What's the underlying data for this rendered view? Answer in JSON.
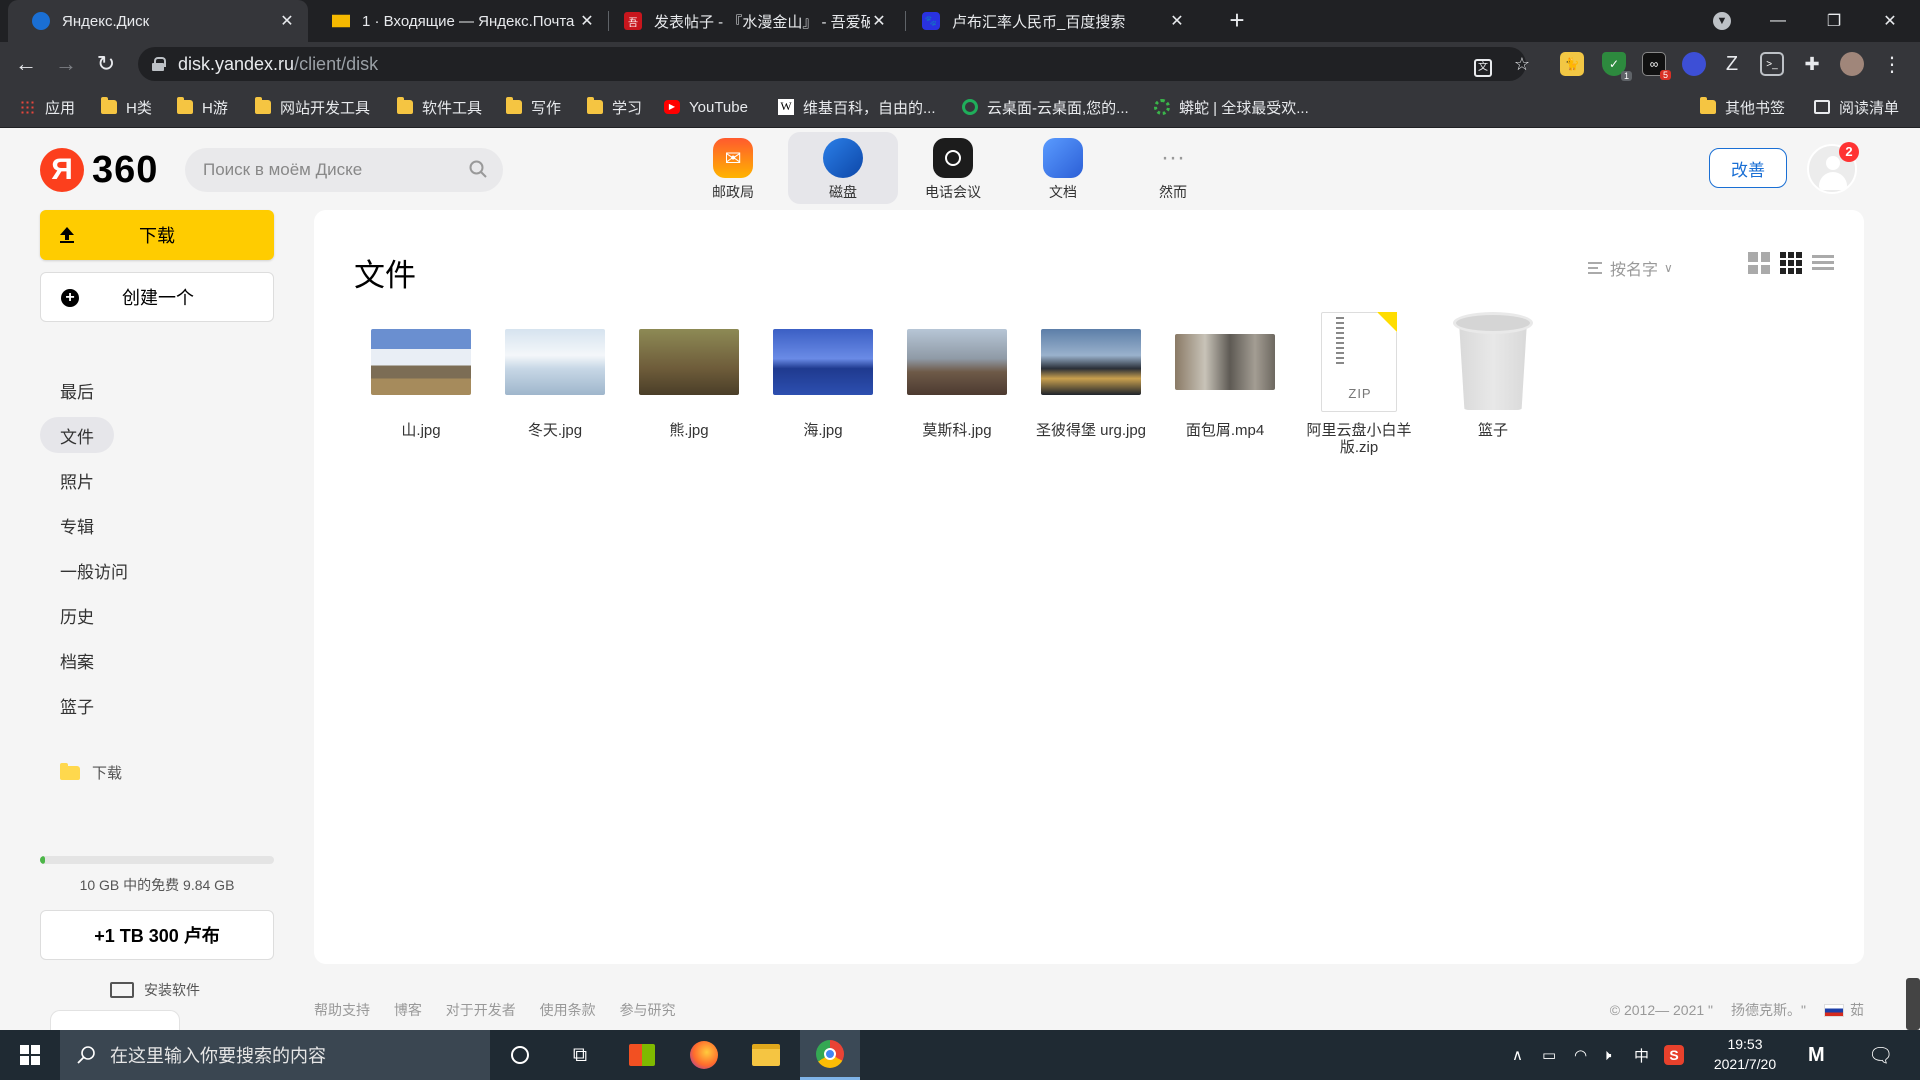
{
  "browser": {
    "tabs": [
      {
        "title": "Яндекс.Диск",
        "favicon": "yandex-disk-icon",
        "active": true
      },
      {
        "title": "1 · Входящие — Яндекс.Почта",
        "favicon": "yandex-mail-icon",
        "active": false
      },
      {
        "title": "发表帖子 - 『水漫金山』 - 吾爱破解",
        "favicon": "52pojie-icon",
        "active": false
      },
      {
        "title": "卢布汇率人民币_百度搜索",
        "favicon": "baidu-icon",
        "active": false
      }
    ],
    "url_host": "disk.yandex.ru",
    "url_path": "/client/disk",
    "bookmarks": [
      {
        "label": "应用",
        "type": "apps"
      },
      {
        "label": "H类",
        "type": "folder"
      },
      {
        "label": "H游",
        "type": "folder"
      },
      {
        "label": "网站开发工具",
        "type": "folder"
      },
      {
        "label": "软件工具",
        "type": "folder"
      },
      {
        "label": "写作",
        "type": "folder"
      },
      {
        "label": "学习",
        "type": "folder"
      },
      {
        "label": "YouTube",
        "type": "youtube"
      },
      {
        "label": "维基百科，自由的...",
        "type": "wikipedia"
      },
      {
        "label": "云桌面-云桌面,您的...",
        "type": "site"
      },
      {
        "label": "蟒蛇 | 全球最受欢...",
        "type": "site"
      },
      {
        "label": "其他书签",
        "type": "folder"
      },
      {
        "label": "阅读清单",
        "type": "reading-list"
      }
    ],
    "extension_badges": {
      "shield": "1",
      "ext5": "5"
    }
  },
  "disk": {
    "logo_letter": "Я",
    "logo_number": "360",
    "search_placeholder": "Поиск в моём Диске",
    "services": [
      {
        "label": "邮政局",
        "icon": "mail-icon",
        "color": "#ff4a2e",
        "active": false
      },
      {
        "label": "磁盘",
        "icon": "disk-icon",
        "color": "#1a6fd4",
        "active": true
      },
      {
        "label": "电话会议",
        "icon": "telemost-icon",
        "color": "#1c1c1c",
        "active": false
      },
      {
        "label": "文档",
        "icon": "docs-icon",
        "color": "#3a7cf0",
        "active": false
      },
      {
        "label": "然而",
        "icon": "more-icon",
        "color": "#999999",
        "active": false
      }
    ],
    "upgrade_label": "改善",
    "notification_count": "2",
    "upload_label": "下载",
    "create_label": "创建一个",
    "nav": [
      {
        "label": "最后",
        "active": false
      },
      {
        "label": "文件",
        "active": true
      },
      {
        "label": "照片",
        "active": false
      },
      {
        "label": "专辑",
        "active": false
      },
      {
        "label": "一般访问",
        "active": false
      },
      {
        "label": "历史",
        "active": false
      },
      {
        "label": "档案",
        "active": false
      },
      {
        "label": "篮子",
        "active": false
      }
    ],
    "folder_link": "下载",
    "quota_used_fraction": 0.016,
    "quota_text": "10 GB 中的免费 9.84 GB",
    "buy_label": "+1 TB 300 卢布",
    "install_label": "安装软件",
    "title": "文件",
    "sort_label": "按名字",
    "files": [
      {
        "name": "山.jpg",
        "kind": "image",
        "palette": "mountain"
      },
      {
        "name": "冬天.jpg",
        "kind": "image",
        "palette": "winter"
      },
      {
        "name": "熊.jpg",
        "kind": "image",
        "palette": "bear"
      },
      {
        "name": "海.jpg",
        "kind": "image",
        "palette": "sea"
      },
      {
        "name": "莫斯科.jpg",
        "kind": "image",
        "palette": "moscow"
      },
      {
        "name": "圣彼得堡 urg.jpg",
        "kind": "image",
        "palette": "spb"
      },
      {
        "name": "面包屑.mp4",
        "kind": "video",
        "palette": "video"
      },
      {
        "name": "阿里云盘小白羊版.zip",
        "kind": "zip",
        "palette": "zip",
        "badge": "ZIP"
      },
      {
        "name": "篮子",
        "kind": "trash",
        "palette": "trash"
      }
    ],
    "footer_links": [
      "帮助支持",
      "博客",
      "对于开发者",
      "使用条款",
      "参与研究"
    ],
    "footer_copyright": "© 2012— 2021 \"",
    "footer_company": "扬德克斯。\"",
    "footer_lang": "茹"
  },
  "taskbar": {
    "search_placeholder": "在这里输入你要搜索的内容",
    "time": "19:53",
    "date": "2021/7/20",
    "ime": "中"
  }
}
